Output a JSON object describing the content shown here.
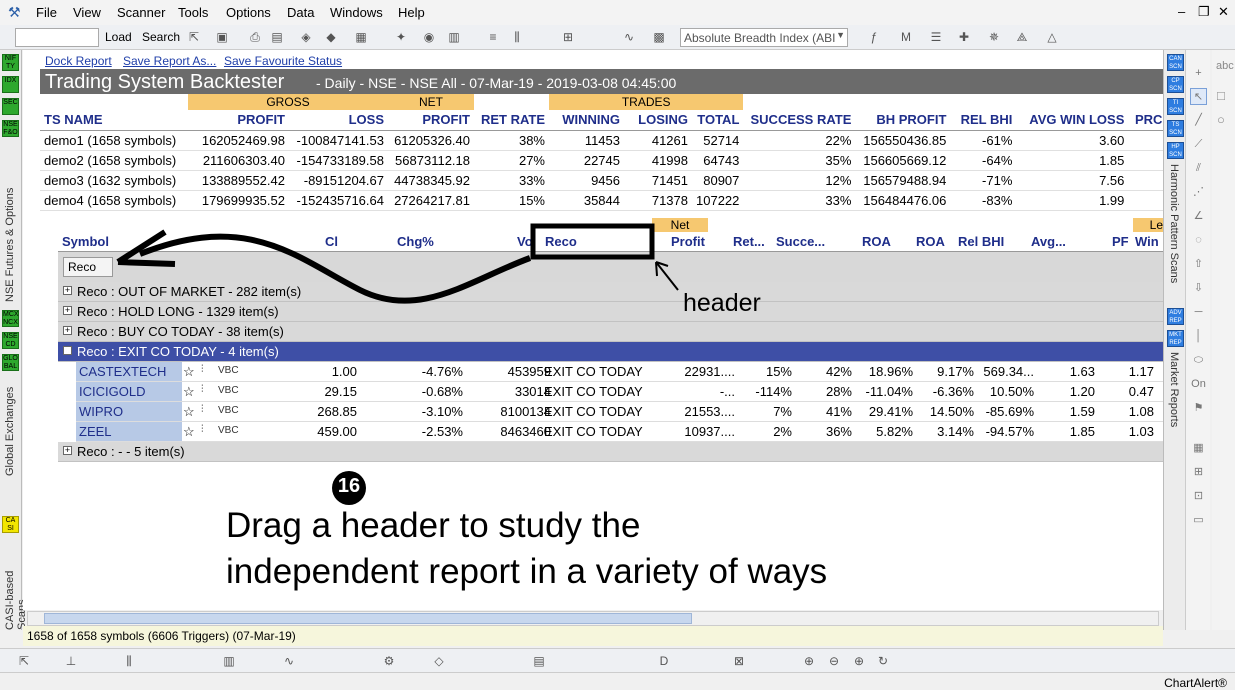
{
  "menu": [
    "File",
    "View",
    "Scanner",
    "Tools",
    "Options",
    "Data",
    "Windows",
    "Help"
  ],
  "toolbar": {
    "load_label": "Load",
    "search_label": "Search",
    "indicator_select": "Absolute Breadth Index (ABI"
  },
  "report_links": {
    "dock": "Dock Report",
    "save_as": "Save Report As...",
    "save_fav": "Save Favourite Status"
  },
  "title": {
    "main": "Trading System Backtester",
    "sub": "- Daily - NSE - NSE All - 07-Mar-19 - 2019-03-08 04:45:00"
  },
  "top_table": {
    "groups": {
      "gross": "GROSS",
      "net": "NET",
      "trades": "TRADES"
    },
    "headers": [
      "TS NAME",
      "PROFIT",
      "LOSS",
      "PROFIT",
      "RET RATE",
      "WINNING",
      "LOSING",
      "TOTAL",
      "SUCCESS RATE",
      "BH PROFIT",
      "REL BHI",
      "AVG WIN LOSS",
      "PRC"
    ],
    "rows": [
      [
        "demo1 (1658 symbols)",
        "162052469.98",
        "-100847141.53",
        "61205326.40",
        "38%",
        "11453",
        "41261",
        "52714",
        "22%",
        "156550436.85",
        "-61%",
        "3.60"
      ],
      [
        "demo2 (1658 symbols)",
        "211606303.40",
        "-154733189.58",
        "56873112.18",
        "27%",
        "22745",
        "41998",
        "64743",
        "35%",
        "156605669.12",
        "-64%",
        "1.85"
      ],
      [
        "demo3 (1632 symbols)",
        "133889552.42",
        "-89151204.67",
        "44738345.92",
        "33%",
        "9456",
        "71451",
        "80907",
        "12%",
        "156579488.94",
        "-71%",
        "7.56"
      ],
      [
        "demo4 (1658 symbols)",
        "179699935.52",
        "-152435716.64",
        "27264217.81",
        "15%",
        "35844",
        "71378",
        "107222",
        "33%",
        "156484476.06",
        "-83%",
        "1.99"
      ]
    ]
  },
  "sub_table": {
    "group_net": "Net",
    "group_le": "Le",
    "headers": {
      "symbol": "Symbol",
      "cl": "Cl",
      "chg": "Chg%",
      "vo": "Vo",
      "reco": "Reco",
      "profit": "Profit",
      "ret": "Ret...",
      "succe": "Succe...",
      "roa1": "ROA",
      "roa2": "ROA",
      "relbhi": "Rel BHI",
      "avg": "Avg...",
      "pf": "PF",
      "win": "Win"
    },
    "drag_button": "Reco",
    "groups": [
      "Reco : OUT OF MARKET - 282 item(s)",
      "Reco : HOLD LONG - 1329 item(s)",
      "Reco : BUY CO TODAY - 38 item(s)",
      "Reco : EXIT CO TODAY - 4 item(s)"
    ],
    "rows": [
      {
        "sym": "CASTEXTECH",
        "cl": "1.00",
        "chg": "-4.76%",
        "vo": "453959",
        "reco": "EXIT CO TODAY",
        "profit": "22931....",
        "ret": "15%",
        "succ": "42%",
        "roa1": "18.96%",
        "roa2": "9.17%",
        "relbhi": "569.34...",
        "avg": "1.63",
        "pf": "1.17"
      },
      {
        "sym": "ICICIGOLD",
        "cl": "29.15",
        "chg": "-0.68%",
        "vo": "33014",
        "reco": "EXIT CO TODAY",
        "profit": "-...",
        "ret": "-114%",
        "succ": "28%",
        "roa1": "-11.04%",
        "roa2": "-6.36%",
        "relbhi": "10.50%",
        "avg": "1.20",
        "pf": "0.47"
      },
      {
        "sym": "WIPRO",
        "cl": "268.85",
        "chg": "-3.10%",
        "vo": "8100134",
        "reco": "EXIT CO TODAY",
        "profit": "21553....",
        "ret": "7%",
        "succ": "41%",
        "roa1": "29.41%",
        "roa2": "14.50%",
        "relbhi": "-85.69%",
        "avg": "1.59",
        "pf": "1.08"
      },
      {
        "sym": "ZEEL",
        "cl": "459.00",
        "chg": "-2.53%",
        "vo": "8463460",
        "reco": "EXIT CO TODAY",
        "profit": "10937....",
        "ret": "2%",
        "succ": "36%",
        "roa1": "5.82%",
        "roa2": "3.14%",
        "relbhi": "-94.57%",
        "avg": "1.85",
        "pf": "1.03"
      }
    ],
    "last_group": "Reco : - - 5 item(s)",
    "row_icons": "VBC"
  },
  "annotation": {
    "header_label": "header",
    "step": "16",
    "caption_line1": "Drag a header to study the",
    "caption_line2": "independent report in a variety of ways"
  },
  "left_panel": {
    "tabs": [
      "NSE Futures & Options",
      "Global Exchanges",
      "CASI-based Scans"
    ],
    "badges": [
      "NIF TY",
      "IDX",
      "SEC",
      "NSE F&O",
      "MCX NCX",
      "NSE CD",
      "GLO BAL",
      "CA SI"
    ]
  },
  "right_panel": {
    "tabs": [
      "Harmonic Pattern Scans",
      "Market Reports"
    ],
    "badges": [
      "CAN SCN",
      "CP SCN",
      "TI SCN",
      "TS SCN",
      "HP SCN",
      "ADV REP",
      "MKT REP"
    ]
  },
  "status": "1658 of 1658 symbols (6606 Triggers) (07-Mar-19)",
  "footer": "ChartAlert®"
}
